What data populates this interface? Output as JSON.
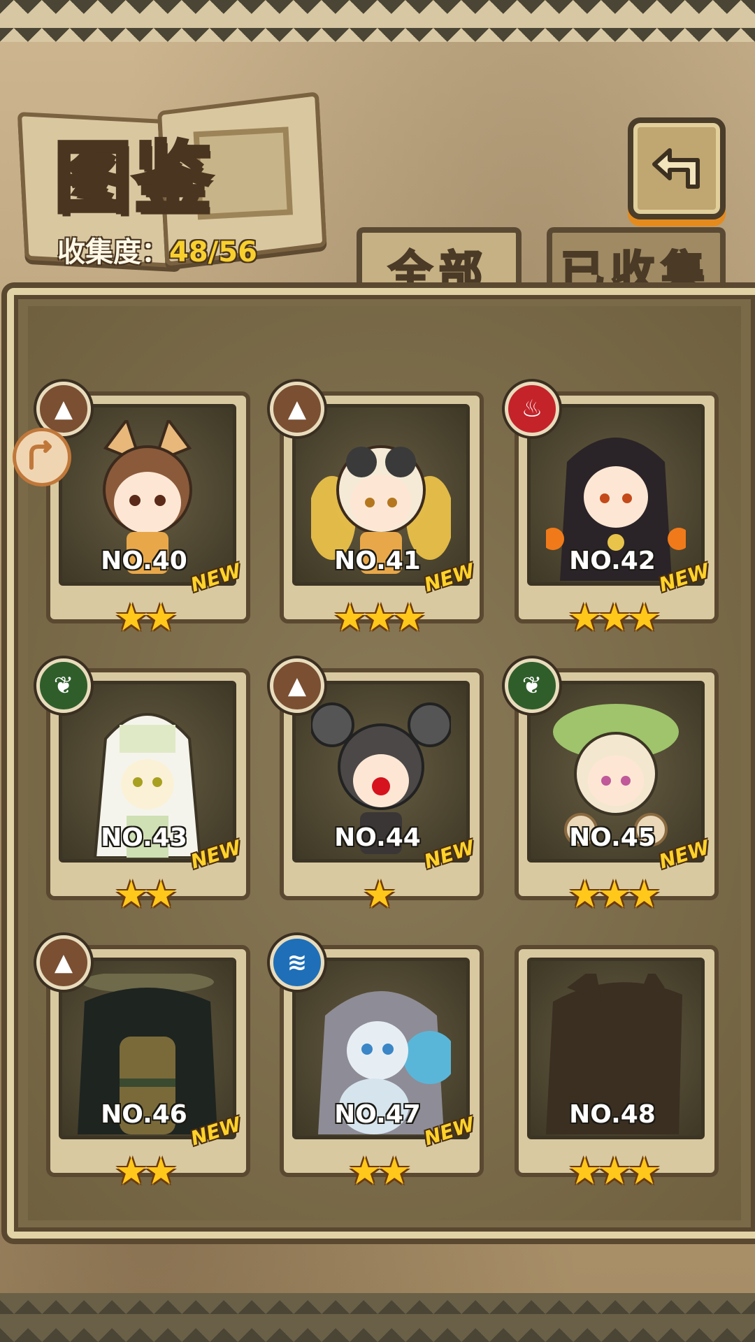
{
  "header": {
    "title": "图鉴",
    "collection_label": "收集度：",
    "collection_value": "48/56"
  },
  "tabs": [
    {
      "label": "全部",
      "active": true
    },
    {
      "label": "已收集",
      "active": false
    }
  ],
  "colors": {
    "accent": "#f8cf2d",
    "earth": "#7a4f32",
    "fire": "#c4232a",
    "grass": "#2f5e2b",
    "water": "#1e6fb8"
  },
  "cards": [
    {
      "number": "NO.40",
      "stars": "★★",
      "star_count": 2,
      "element": "earth-icon",
      "new": "NEW"
    },
    {
      "number": "NO.41",
      "stars": "★★★",
      "star_count": 3,
      "element": "earth-icon",
      "new": "NEW"
    },
    {
      "number": "NO.42",
      "stars": "★★★",
      "star_count": 3,
      "element": "fire-icon",
      "new": "NEW"
    },
    {
      "number": "NO.43",
      "stars": "★★",
      "star_count": 2,
      "element": "grass-icon",
      "new": "NEW"
    },
    {
      "number": "NO.44",
      "stars": "★",
      "star_count": 1,
      "element": "earth-icon",
      "new": "NEW"
    },
    {
      "number": "NO.45",
      "stars": "★★★",
      "star_count": 3,
      "element": "grass-icon",
      "new": "NEW"
    },
    {
      "number": "NO.46",
      "stars": "★★",
      "star_count": 2,
      "element": "earth-icon",
      "new": "NEW"
    },
    {
      "number": "NO.47",
      "stars": "★★",
      "star_count": 2,
      "element": "water-icon",
      "new": "NEW"
    },
    {
      "number": "NO.48",
      "stars": "★★★",
      "star_count": 3,
      "element": "",
      "new": "",
      "locked": true
    }
  ]
}
